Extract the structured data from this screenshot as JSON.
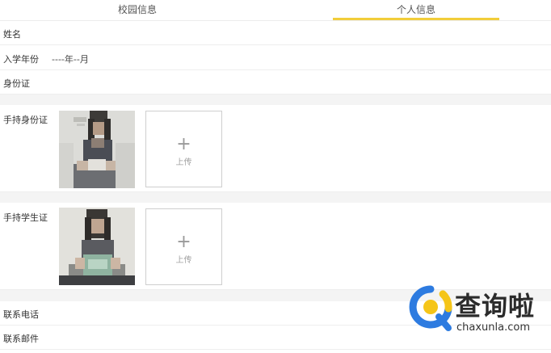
{
  "tabs": [
    {
      "label": "校园信息",
      "active": false
    },
    {
      "label": "个人信息",
      "active": true
    }
  ],
  "fields": {
    "name_label": "姓名",
    "enroll_label": "入学年份",
    "enroll_value": "----年--月",
    "id_label": "身份证",
    "hold_id_label": "手持身份证",
    "hold_student_label": "手持学生证",
    "phone_label": "联系电话",
    "email_label": "联系邮件"
  },
  "upload": {
    "label": "上传",
    "icon": "plus-icon"
  },
  "watermark": {
    "brand": "查询啦",
    "url": "chaxunla.com",
    "colors": {
      "blue": "#2d7be0",
      "yellow": "#f5c518"
    }
  },
  "colors": {
    "accent": "#f2cd3a",
    "divider": "#eeeeee",
    "gap": "#f4f4f4"
  }
}
